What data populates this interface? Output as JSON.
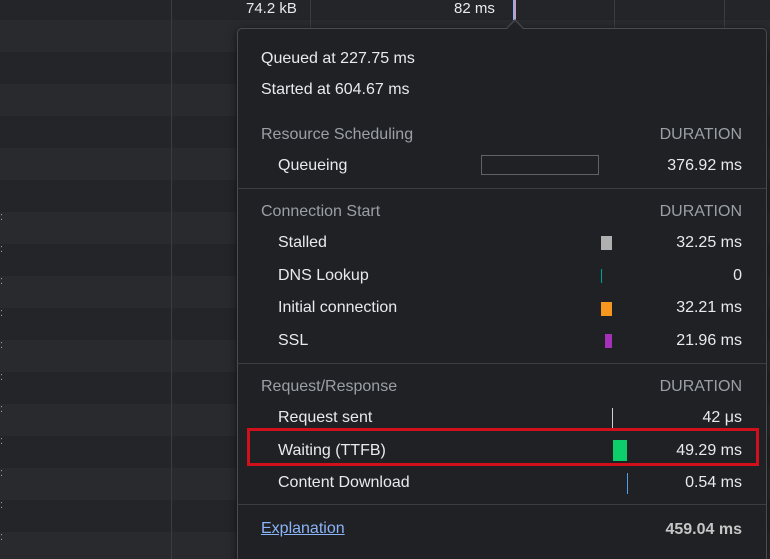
{
  "top_row": {
    "size": "74.2 kB",
    "time": "82 ms"
  },
  "popover": {
    "queued_at": "Queued at 227.75 ms",
    "started_at": "Started at 604.67 ms",
    "sections": [
      {
        "title": "Resource Scheduling",
        "duration_header": "DURATION",
        "rows": [
          {
            "label": "Queueing",
            "value": "376.92 ms",
            "color": "#202124"
          }
        ]
      },
      {
        "title": "Connection Start",
        "duration_header": "DURATION",
        "rows": [
          {
            "label": "Stalled",
            "value": "32.25 ms",
            "color": "#b0b0b0"
          },
          {
            "label": "DNS Lookup",
            "value": "0",
            "color": "#00a09a"
          },
          {
            "label": "Initial connection",
            "value": "32.21 ms",
            "color": "#f7961e"
          },
          {
            "label": "SSL",
            "value": "21.96 ms",
            "color": "#a630b8"
          }
        ]
      },
      {
        "title": "Request/Response",
        "duration_header": "DURATION",
        "rows": [
          {
            "label": "Request sent",
            "value": "42 μs",
            "color": "#d0d0d0"
          },
          {
            "label": "Waiting (TTFB)",
            "value": "49.29 ms",
            "color": "#0cce6b"
          },
          {
            "label": "Content Download",
            "value": "0.54 ms",
            "color": "#4e9fe8"
          }
        ]
      }
    ],
    "explanation_link": "Explanation",
    "total": "459.04 ms"
  },
  "highlight_color": "#d0101a"
}
